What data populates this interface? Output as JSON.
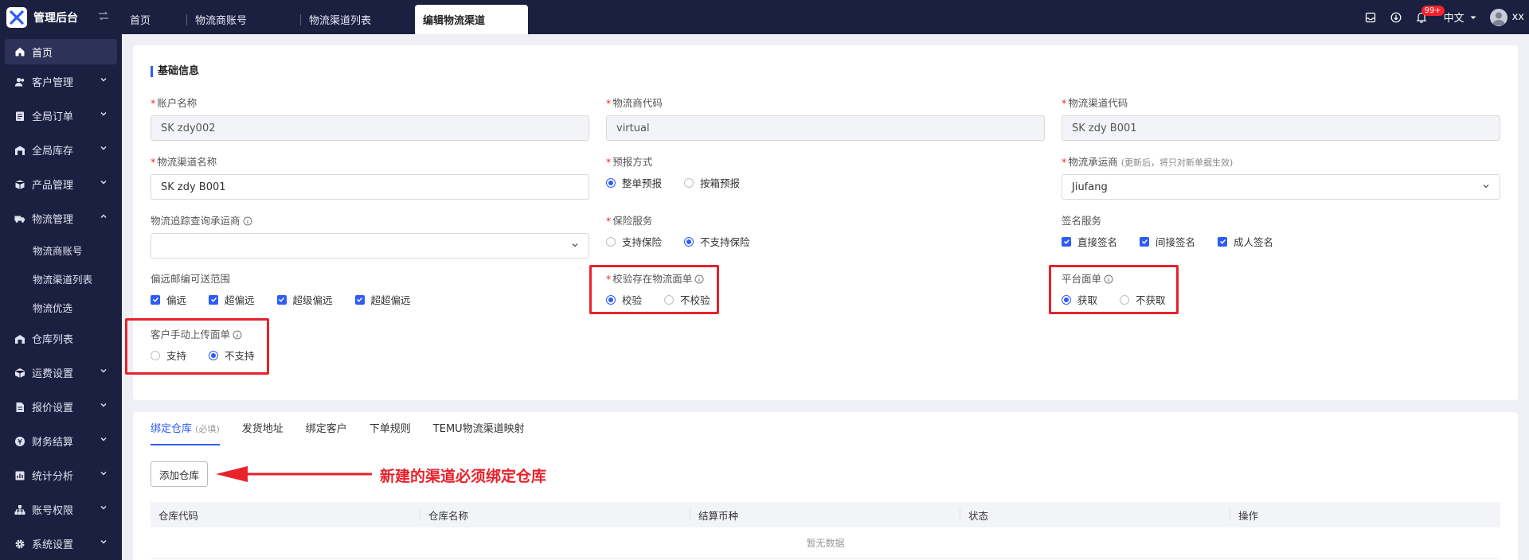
{
  "brand": {
    "title": "管理后台"
  },
  "tabs": [
    {
      "label": "首页"
    },
    {
      "label": "物流商账号"
    },
    {
      "label": "物流渠道列表"
    },
    {
      "label": "编辑物流渠道"
    }
  ],
  "header": {
    "badge": "99+",
    "language": "中文",
    "user": "xx"
  },
  "sidebar": {
    "items": [
      {
        "label": "首页",
        "icon": "home-icon"
      },
      {
        "label": "客户管理",
        "icon": "users-icon"
      },
      {
        "label": "全局订单",
        "icon": "clipboard-icon"
      },
      {
        "label": "全局库存",
        "icon": "warehouse-icon"
      },
      {
        "label": "产品管理",
        "icon": "box-icon"
      },
      {
        "label": "物流管理",
        "icon": "truck-icon"
      }
    ],
    "sub_items": [
      {
        "label": "物流商账号"
      },
      {
        "label": "物流渠道列表"
      },
      {
        "label": "物流优选"
      }
    ],
    "items_after": [
      {
        "label": "仓库列表",
        "icon": "building-icon"
      },
      {
        "label": "运费设置",
        "icon": "cube-icon"
      },
      {
        "label": "报价设置",
        "icon": "file-icon"
      },
      {
        "label": "财务结算",
        "icon": "coin-icon"
      },
      {
        "label": "统计分析",
        "icon": "chart-icon"
      },
      {
        "label": "账号权限",
        "icon": "org-icon"
      },
      {
        "label": "系统设置",
        "icon": "gear-icon"
      }
    ]
  },
  "form": {
    "section_title": "基础信息",
    "account_name": {
      "label": "账户名称",
      "value": "SK zdy002"
    },
    "provider_code": {
      "label": "物流商代码",
      "value": "virtual"
    },
    "channel_code": {
      "label": "物流渠道代码",
      "value": "SK zdy B001"
    },
    "channel_name": {
      "label": "物流渠道名称",
      "value": "SK zdy B001"
    },
    "forecast": {
      "label": "预报方式",
      "options": [
        "整单预报",
        "按箱预报"
      ],
      "selected": 0
    },
    "carrier": {
      "label": "物流承运商",
      "note": "(更新后，将只对新单据生效)",
      "value": "Jiufang"
    },
    "tracking": {
      "label": "物流追踪查询承运商",
      "value": ""
    },
    "insurance": {
      "label": "保险服务",
      "options": [
        "支持保险",
        "不支持保险"
      ],
      "selected": 1
    },
    "signature": {
      "label": "签名服务",
      "options": [
        "直接签名",
        "间接签名",
        "成人签名"
      ]
    },
    "remote": {
      "label": "偏远邮编可送范围",
      "options": [
        "偏远",
        "超偏远",
        "超级偏远",
        "超超偏远"
      ]
    },
    "verify": {
      "label": "校验存在物流面单",
      "options": [
        "校验",
        "不校验"
      ],
      "selected": 0
    },
    "platform": {
      "label": "平台面单",
      "options": [
        "获取",
        "不获取"
      ],
      "selected": 0
    },
    "manual_upload": {
      "label": "客户手动上传面单",
      "options": [
        "支持",
        "不支持"
      ],
      "selected": 1
    }
  },
  "bind": {
    "tabs": [
      {
        "label": "绑定仓库",
        "hint": "(必填)"
      },
      {
        "label": "发货地址"
      },
      {
        "label": "绑定客户"
      },
      {
        "label": "下单规则"
      },
      {
        "label": "TEMU物流渠道映射"
      }
    ],
    "add_button": "添加仓库",
    "callout": "新建的渠道必须绑定仓库",
    "columns": [
      "仓库代码",
      "仓库名称",
      "结算币种",
      "状态",
      "操作"
    ],
    "empty": "暂无数据"
  },
  "colors": {
    "primary": "#2d5cf6",
    "sidebar_bg": "#1c2040",
    "highlight": "#e8212a",
    "required": "#f5222d"
  }
}
